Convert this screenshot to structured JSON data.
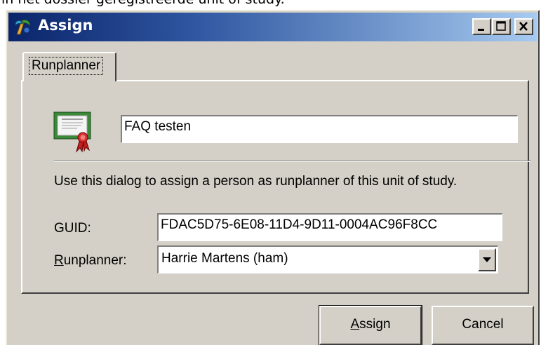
{
  "background_caption": "in het dossier geregistreerde unit of study.",
  "window": {
    "title": "Assign",
    "icon": "app-icon",
    "controls": {
      "minimize": "minimize-icon",
      "maximize": "maximize-icon",
      "close": "close-icon"
    }
  },
  "tabs": [
    {
      "label": "Runplanner",
      "active": true
    }
  ],
  "form": {
    "icon": "certificate-icon",
    "name_value": "FAQ testen",
    "description": "Use this dialog to assign a person as runplanner of this unit of study.",
    "guid_label": "GUID:",
    "guid_value": "FDAC5D75-6E08-11D4-9D11-0004AC96F8CC",
    "runplanner_label_accel": "R",
    "runplanner_label_rest": "unplanner:",
    "runplanner_value": "Harrie Martens (ham)"
  },
  "buttons": {
    "assign_accel": "A",
    "assign_rest": "ssign",
    "cancel": "Cancel"
  },
  "colors": {
    "titlebar_start": "#0a246a",
    "titlebar_end": "#a6caf0",
    "face": "#d4d0c8"
  }
}
